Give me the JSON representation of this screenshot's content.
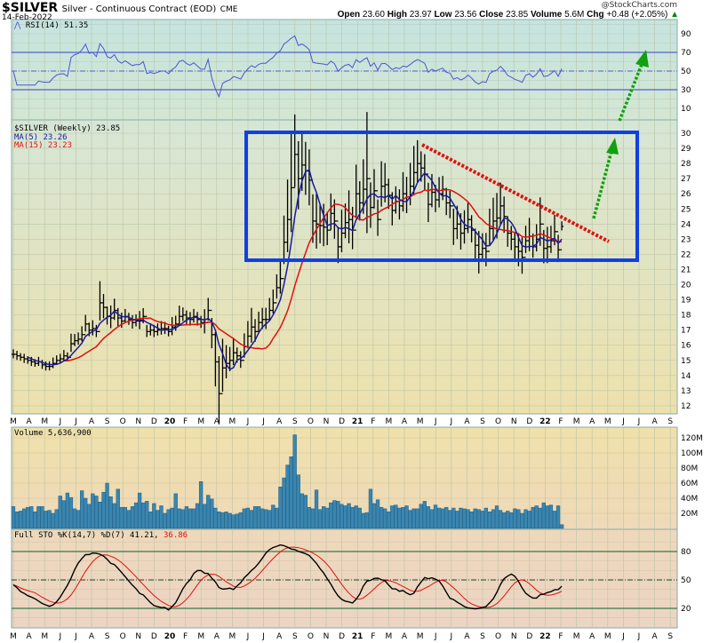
{
  "header": {
    "symbol": "$SILVER",
    "description": "Silver - Continuous Contract (EOD)",
    "exchange": "CME",
    "date": "14-Feb-2022",
    "credit": "@StockCharts.com",
    "open_label": "Open",
    "open": "23.60",
    "high_label": "High",
    "high": "23.97",
    "low_label": "Low",
    "low": "23.56",
    "close_label": "Close",
    "close": "23.85",
    "volume_label": "Volume",
    "volume": "5.6M",
    "chg_label": "Chg",
    "chg": "+0.48 (+2.05%)"
  },
  "colors": {
    "price": "#000000",
    "ma5": "#1a1aa0",
    "ma15": "#e01010",
    "volume": "#3a86b0",
    "rsi": "#4a55d0",
    "box": "#1040e0",
    "trend": "#e01010",
    "arrow": "#10a010"
  },
  "chart_data": [
    {
      "type": "line",
      "title": "RSI(14) 51.35",
      "panel": "rsi",
      "ylim": [
        0,
        100
      ],
      "ticks": [
        "90",
        "70",
        "50",
        "30",
        "10"
      ],
      "tick_values": [
        90,
        70,
        50,
        30,
        10
      ],
      "reference_lines": [
        70,
        50,
        30
      ]
    },
    {
      "type": "ohlc",
      "panel": "price",
      "title": "$SILVER (Weekly) 23.85",
      "legend": [
        "MA(5) 23.26",
        "MA(15) 23.23"
      ],
      "ylim": [
        11.2,
        30.8
      ],
      "ticks": [
        "30",
        "29",
        "28",
        "27",
        "26",
        "25",
        "24",
        "23",
        "22",
        "21",
        "20",
        "19",
        "18",
        "17",
        "16",
        "15",
        "14",
        "13",
        "12"
      ],
      "tick_values": [
        30,
        29,
        28,
        27,
        26,
        25,
        24,
        23,
        22,
        21,
        20,
        19,
        18,
        17,
        16,
        15,
        14,
        13,
        12
      ],
      "x_labels": [
        "M",
        "A",
        "M",
        "J",
        "J",
        "A",
        "S",
        "O",
        "N",
        "D",
        "20",
        "F",
        "M",
        "A",
        "M",
        "J",
        "J",
        "A",
        "S",
        "O",
        "N",
        "D",
        "21",
        "F",
        "M",
        "A",
        "M",
        "J",
        "J",
        "A",
        "S",
        "O",
        "N",
        "D",
        "22",
        "F",
        "M",
        "A",
        "M",
        "J",
        "J",
        "A",
        "S"
      ],
      "close": [
        15.4,
        15.3,
        15.2,
        15.1,
        15.0,
        14.9,
        14.8,
        14.9,
        14.7,
        14.6,
        14.6,
        14.8,
        15.0,
        15.1,
        15.3,
        15.2,
        16.1,
        16.3,
        16.4,
        16.7,
        17.4,
        17.0,
        17.1,
        16.9,
        18.8,
        18.5,
        17.9,
        17.8,
        18.3,
        17.8,
        17.6,
        17.9,
        17.7,
        17.5,
        17.6,
        17.6,
        17.9,
        16.9,
        17.0,
        16.9,
        17.0,
        17.1,
        17.1,
        16.9,
        17.2,
        17.4,
        17.9,
        18.0,
        17.8,
        17.7,
        17.9,
        17.7,
        17.5,
        17.5,
        18.3,
        16.7,
        14.9,
        12.8,
        14.5,
        14.8,
        15.0,
        15.5,
        15.3,
        15.0,
        15.9,
        16.6,
        17.2,
        16.9,
        17.5,
        17.7,
        17.7,
        18.3,
        18.8,
        19.8,
        20.4,
        22.8,
        24.3,
        26.4,
        28.6,
        27.0,
        27.9,
        27.5,
        26.9,
        24.2,
        24.0,
        23.9,
        23.8,
        23.6,
        24.7,
        24.2,
        22.5,
        23.4,
        24.1,
        24.3,
        23.6,
        26.0,
        25.4,
        26.3,
        27.0,
        25.1,
        26.2,
        24.3,
        26.5,
        26.6,
        25.9,
        24.9,
        25.5,
        25.2,
        26.0,
        25.8,
        26.5,
        27.4,
        28.0,
        27.7,
        27.3,
        25.3,
        26.1,
        25.6,
        26.0,
        26.3,
        25.4,
        25.2,
        23.7,
        24.0,
        23.4,
        23.7,
        24.3,
        23.6,
        22.6,
        22.0,
        22.4,
        22.2,
        23.7,
        24.2,
        24.4,
        25.2,
        24.5,
        23.4,
        23.0,
        22.5,
        22.2,
        21.8,
        22.9,
        23.2,
        22.5,
        23.0,
        24.0,
        22.4,
        22.5,
        22.9,
        23.5,
        22.3,
        23.85
      ],
      "range": [
        0.6,
        0.6,
        0.5,
        0.6,
        0.5,
        0.6,
        0.5,
        0.6,
        0.6,
        0.6,
        0.6,
        0.7,
        0.6,
        0.6,
        0.7,
        0.6,
        1.2,
        0.8,
        0.8,
        1.0,
        1.1,
        0.9,
        1.0,
        0.8,
        2.6,
        1.6,
        1.2,
        1.5,
        1.4,
        1.2,
        1.0,
        0.9,
        0.8,
        0.9,
        0.8,
        1.2,
        1.0,
        0.8,
        0.8,
        0.8,
        0.8,
        0.9,
        0.8,
        0.7,
        1.2,
        1.0,
        1.3,
        0.9,
        0.9,
        0.9,
        0.9,
        0.9,
        0.8,
        1.6,
        1.5,
        2.0,
        3.6,
        4.5,
        3.5,
        2.2,
        1.6,
        1.8,
        1.0,
        1.1,
        1.6,
        1.8,
        2.3,
        1.5,
        1.3,
        1.4,
        1.4,
        1.5,
        1.6,
        1.6,
        2.2,
        3.2,
        4.8,
        6.5,
        4.8,
        4.5,
        3.8,
        3.5,
        3.7,
        3.2,
        3.6,
        2.6,
        2.8,
        2.2,
        2.4,
        2.6,
        2.4,
        2.8,
        2.3,
        3.5,
        2.8,
        3.5,
        2.6,
        3.6,
        8.0,
        3.0,
        2.6,
        2.4,
        3.0,
        2.6,
        2.0,
        2.2,
        1.8,
        2.0,
        2.6,
        2.4,
        2.8,
        3.2,
        2.8,
        2.0,
        2.4,
        2.6,
        2.2,
        1.8,
        2.0,
        1.6,
        1.8,
        1.8,
        2.4,
        2.2,
        2.4,
        2.2,
        2.0,
        1.8,
        2.0,
        2.8,
        1.8,
        2.2,
        2.4,
        2.8,
        3.0,
        2.8,
        2.4,
        2.0,
        1.6,
        1.8,
        2.2,
        2.4,
        1.8,
        2.2,
        1.6,
        1.8,
        3.2,
        2.2,
        2.4,
        1.8,
        2.0,
        1.8,
        0.6
      ],
      "annotations": [
        "consolidation box 21.6-30",
        "downtrend line",
        "breakout arrows"
      ]
    },
    {
      "type": "bar",
      "panel": "volume",
      "title": "Volume 5,636,900",
      "unit": "M",
      "ylim": [
        0,
        130
      ],
      "ticks": [
        "120M",
        "100M",
        "80M",
        "60M",
        "40M",
        "20M"
      ],
      "tick_values": [
        120,
        100,
        80,
        60,
        40,
        20
      ],
      "values": [
        29,
        22,
        23,
        26,
        28,
        29,
        22,
        29,
        29,
        23,
        24,
        20,
        25,
        43,
        37,
        47,
        41,
        26,
        24,
        50,
        40,
        32,
        46,
        43,
        35,
        48,
        60,
        42,
        33,
        52,
        28,
        28,
        24,
        29,
        34,
        47,
        34,
        36,
        22,
        33,
        24,
        30,
        20,
        25,
        27,
        46,
        26,
        25,
        29,
        26,
        26,
        33,
        62,
        32,
        44,
        39,
        27,
        22,
        21,
        22,
        20,
        18,
        19,
        21,
        26,
        27,
        24,
        29,
        29,
        26,
        25,
        24,
        31,
        27,
        55,
        67,
        84,
        95,
        124,
        71,
        46,
        44,
        28,
        26,
        51,
        25,
        29,
        27,
        34,
        37,
        36,
        32,
        30,
        33,
        28,
        30,
        27,
        20,
        21,
        52,
        33,
        38,
        28,
        26,
        22,
        30,
        31,
        27,
        28,
        30,
        24,
        26,
        26,
        32,
        36,
        29,
        25,
        31,
        27,
        26,
        28,
        24,
        27,
        23,
        27,
        26,
        25,
        22,
        26,
        25,
        23,
        27,
        22,
        25,
        30,
        24,
        21,
        23,
        21,
        26,
        25,
        20,
        25,
        23,
        28,
        30,
        27,
        34,
        30,
        31,
        23,
        30,
        5
      ]
    },
    {
      "type": "line",
      "panel": "stochastic",
      "title_prefix": "Full STO %K(14,7) %D(7) 41.21,",
      "d_value": "36.86",
      "ylim": [
        0,
        100
      ],
      "ticks": [
        "80",
        "50",
        "20"
      ],
      "tick_values": [
        80,
        50,
        20
      ]
    }
  ]
}
